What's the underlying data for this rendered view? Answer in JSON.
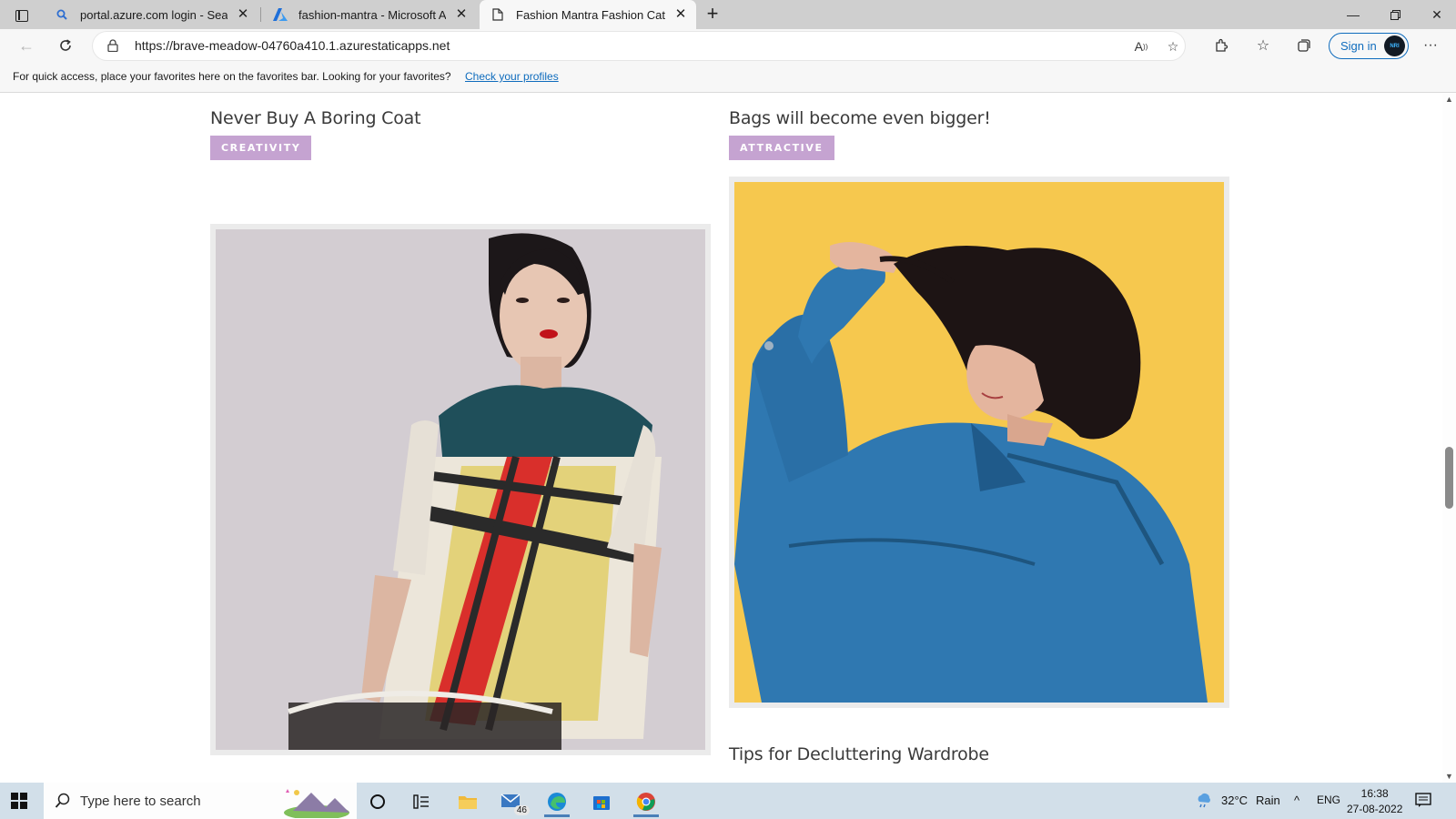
{
  "browser": {
    "tabs": [
      {
        "title": "portal.azure.com login - Search",
        "icon": "search-icon"
      },
      {
        "title": "fashion-mantra - Microsoft Azure",
        "icon": "azure-logo-icon"
      },
      {
        "title": "Fashion Mantra Fashion Category",
        "icon": "page-icon",
        "active": true
      }
    ],
    "address_url": "https://brave-meadow-04760a410.1.azurestaticapps.net",
    "signin_label": "Sign in",
    "avatar_text": "NRI",
    "favorites_message": "For quick access, place your favorites here on the favorites bar. Looking for your favorites?",
    "favorites_link": "Check your profiles"
  },
  "posts": [
    {
      "title": "Never Buy A Boring Coat",
      "tag": "CREATIVITY"
    },
    {
      "title": "Bags will become even bigger!",
      "tag": "ATTRACTIVE"
    },
    {
      "title": "Tips for Decluttering Wardrobe"
    }
  ],
  "colors": {
    "tag_bg": "#c5a3d1",
    "image_frame": "#ebebeb",
    "accent": "#0f6cbd"
  },
  "taskbar": {
    "search_placeholder": "Type here to search",
    "mail_badge": "46",
    "weather_temp": "32°C",
    "weather_text": "Rain",
    "language": "ENG",
    "time": "16:38",
    "date": "27-08-2022"
  }
}
